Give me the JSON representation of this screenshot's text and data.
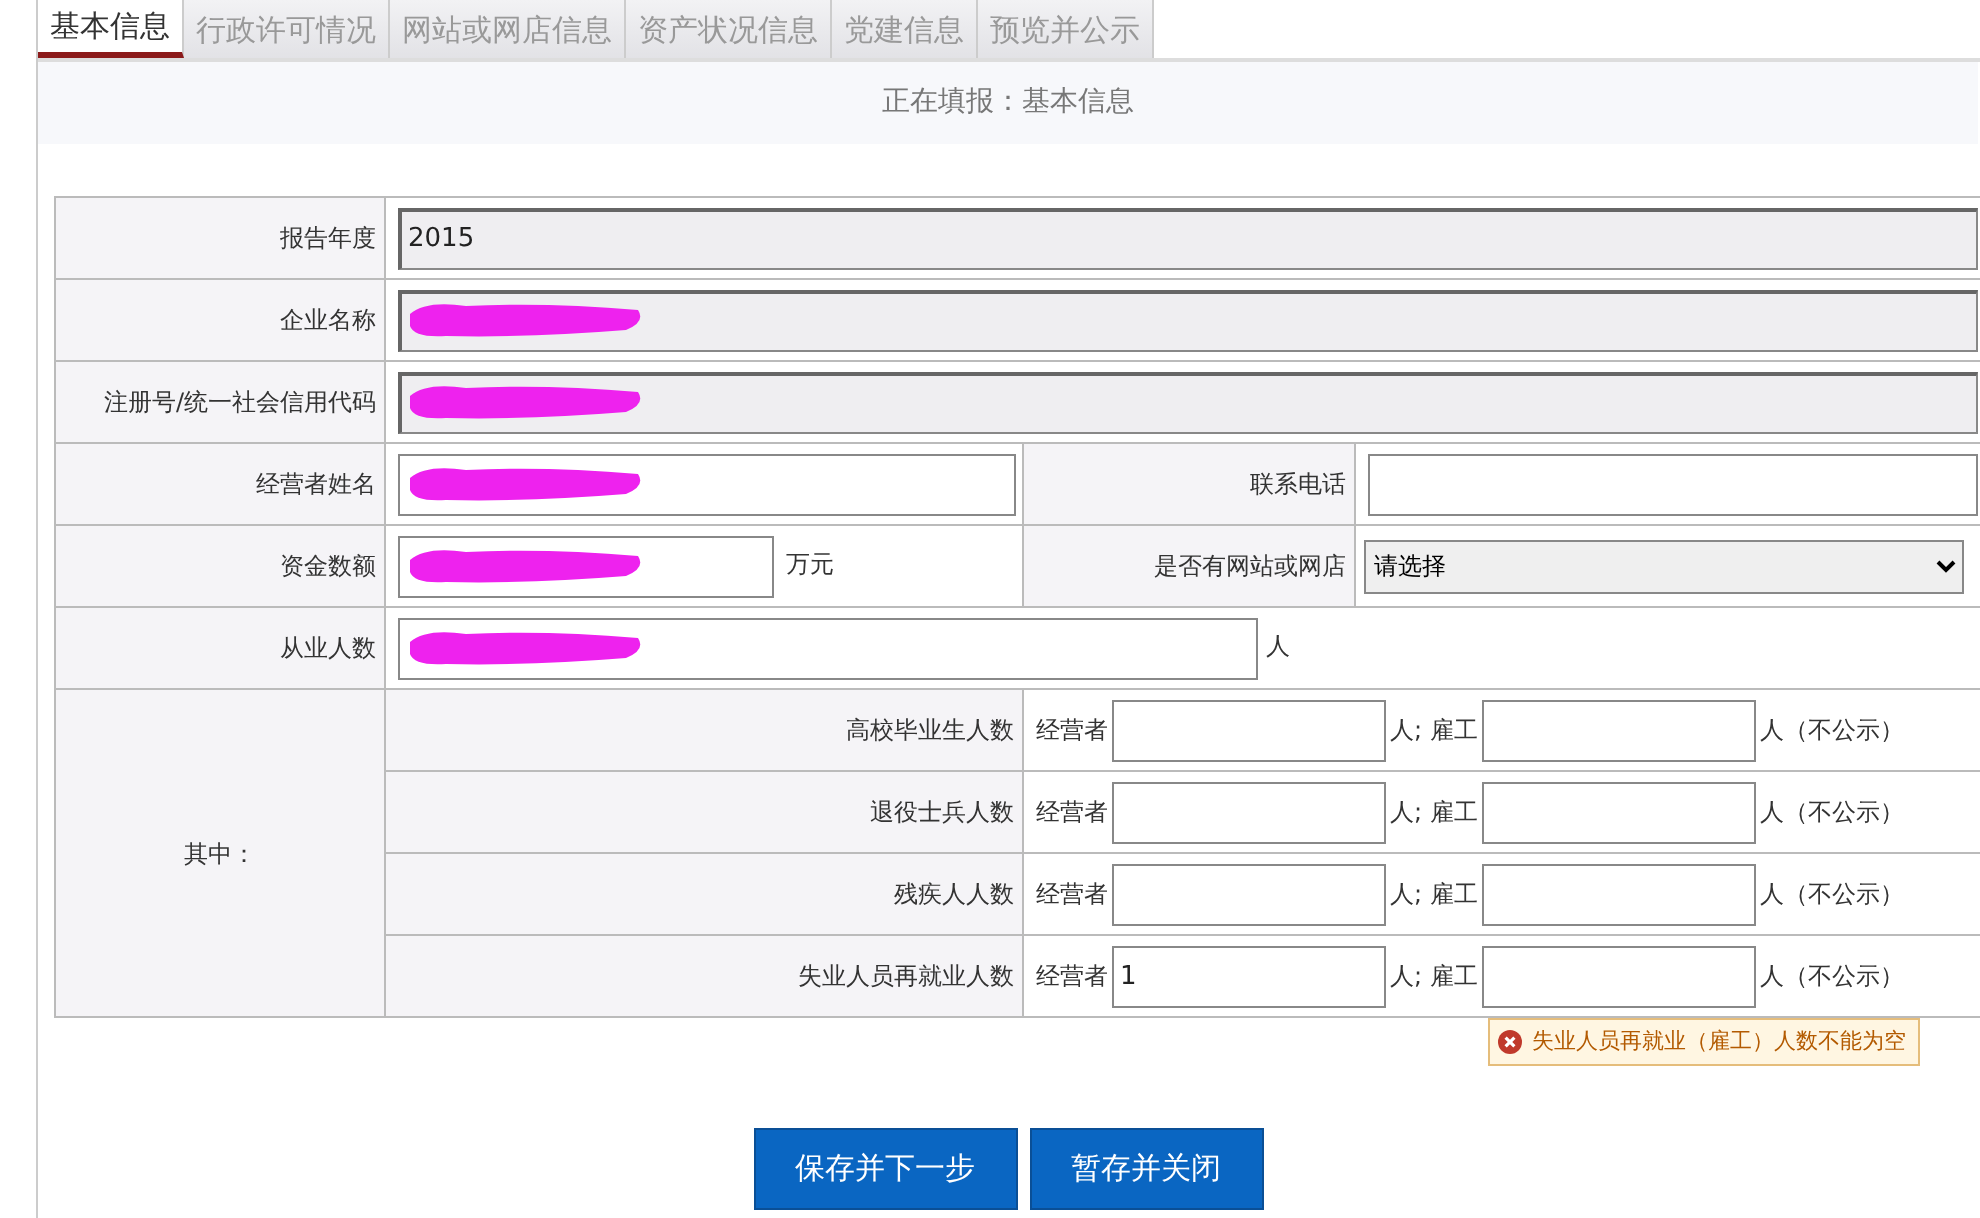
{
  "tabs": [
    {
      "label": "基本信息",
      "selected": true
    },
    {
      "label": "行政许可情况",
      "selected": false
    },
    {
      "label": "网站或网店信息",
      "selected": false
    },
    {
      "label": "资产状况信息",
      "selected": false
    },
    {
      "label": "党建信息",
      "selected": false
    },
    {
      "label": "预览并公示",
      "selected": false
    }
  ],
  "status": "正在填报：基本信息",
  "rows": [
    {
      "kind": "wide",
      "label": "报告年度",
      "readonly": true,
      "value": "2015"
    },
    {
      "kind": "wide",
      "label": "企业名称",
      "readonly": true,
      "redacted": true
    },
    {
      "kind": "wide",
      "label": "注册号/统一社会信用代码",
      "readonly": true,
      "redacted": true
    },
    {
      "kind": "pair",
      "fields": [
        {
          "label": "经营者姓名",
          "kind": "text",
          "redacted": true
        },
        {
          "label": "联系电话",
          "kind": "text"
        }
      ]
    },
    {
      "kind": "pair",
      "fields": [
        {
          "label": "资金数额",
          "kind": "text",
          "redacted": true,
          "unit": "万元"
        },
        {
          "label": "是否有网站或网店",
          "kind": "select",
          "value": "请选择"
        }
      ]
    },
    {
      "kind": "unit",
      "label": "从业人数",
      "redacted": true,
      "unit": "人"
    }
  ],
  "breakdown": {
    "label": "其中：",
    "items": [
      {
        "label": "高校毕业生人数",
        "operator_label": "经营者",
        "middle": "人; 雇工",
        "suffix": "人（不公示）"
      },
      {
        "label": "退役士兵人数",
        "operator_label": "经营者",
        "middle": "人; 雇工",
        "suffix": "人（不公示）"
      },
      {
        "label": "残疾人人数",
        "operator_label": "经营者",
        "middle": "人; 雇工",
        "suffix": "人（不公示）"
      },
      {
        "label": "失业人员再就业人数",
        "operator_label": "经营者",
        "operator_value": "1",
        "middle": "人; 雇工",
        "suffix": "人（不公示）",
        "error": "失业人员再就业（雇工）人数不能为空"
      }
    ]
  },
  "buttons": [
    "保存并下一步",
    "暂存并关闭"
  ]
}
